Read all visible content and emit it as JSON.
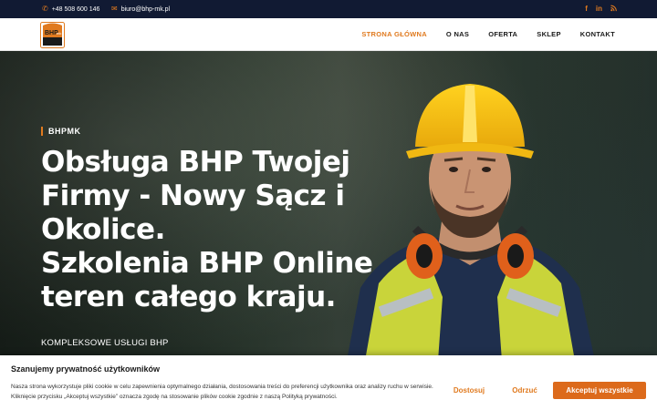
{
  "topbar": {
    "phone": "+48 508 600 146",
    "email": "biuro@bhp-mk.pl",
    "phone_icon": "phone-icon",
    "email_icon": "envelope-icon",
    "social": [
      "facebook-icon",
      "linkedin-icon",
      "rss-icon"
    ]
  },
  "logo": {
    "text": "BHP",
    "badge": "mk"
  },
  "nav": {
    "items": [
      "STRONA GŁÓWNA",
      "O NAS",
      "OFERTA",
      "SKLEP",
      "KONTAKT"
    ],
    "active_index": 0
  },
  "hero": {
    "tag": "BHPMK",
    "headline": [
      "Obsługa BHP Twojej",
      "Firmy - Nowy Sącz i",
      "Okolice.",
      "Szkolenia BHP Online",
      "teren całego kraju."
    ],
    "subtitle": "KOMPLEKSOWE USŁUGI BHP"
  },
  "cookie": {
    "title": "Szanujemy prywatność użytkowników",
    "text": "Nasza strona wykorzystuje pliki cookie w celu zapewnienia optymalnego działania, dostosowania treści do preferencji użytkownika oraz analizy ruchu w serwisie. Kliknięcie przycisku „Akceptuj wszystkie” oznacza zgodę na stosowanie plików cookie zgodnie z naszą Polityką prywatności.",
    "customize_label": "Dostosuj",
    "reject_label": "Odrzuć",
    "accept_label": "Akceptuj wszystkie"
  },
  "colors": {
    "accent": "#e07a1f",
    "topbar": "#111a33",
    "text_dark": "#1a1a1a"
  }
}
